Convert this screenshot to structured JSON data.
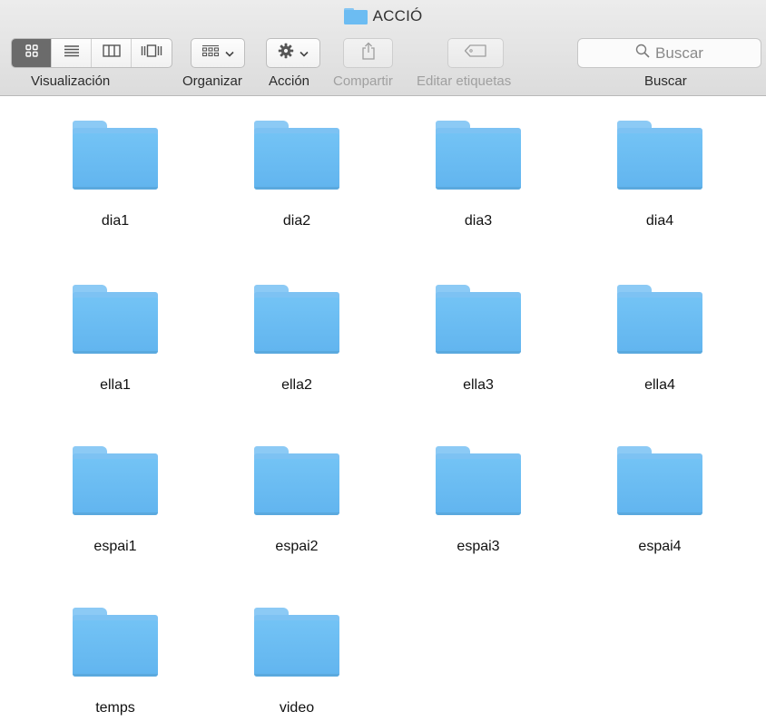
{
  "window": {
    "title": "ACCIÓ"
  },
  "toolbar": {
    "view_label": "Visualización",
    "organize_label": "Organizar",
    "action_label": "Acción",
    "share_label": "Compartir",
    "tags_label": "Editar etiquetas",
    "search_label": "Buscar",
    "search_placeholder": "Buscar"
  },
  "icons": {
    "view_icons": "grid-icon",
    "view_list": "list-icon",
    "view_columns": "columns-icon",
    "view_coverflow": "coverflow-icon",
    "organize": "group-icon",
    "action": "gear-icon",
    "share": "share-icon",
    "tags": "tag-icon",
    "search": "magnifier-icon"
  },
  "colors": {
    "folder": "#6cbcf2",
    "active_segment": "#6b6b6b"
  },
  "folders": [
    "dia1",
    "dia2",
    "dia3",
    "dia4",
    "ella1",
    "ella2",
    "ella3",
    "ella4",
    "espai1",
    "espai2",
    "espai3",
    "espai4",
    "temps",
    "video"
  ]
}
